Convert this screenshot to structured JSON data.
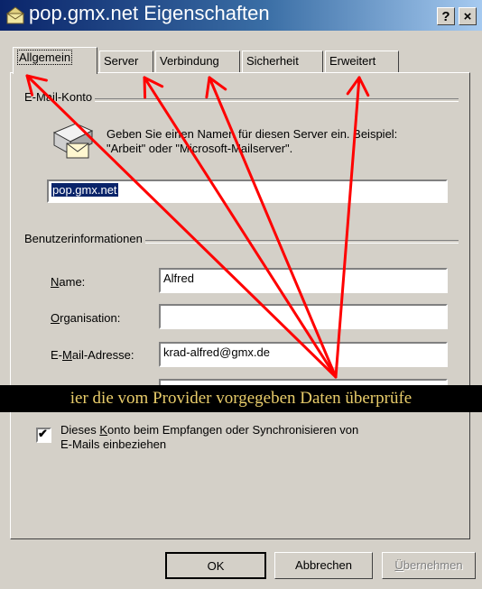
{
  "window": {
    "title": "pop.gmx.net Eigenschaften",
    "help_label": "?",
    "close_label": "×"
  },
  "tabs": [
    {
      "label": "Allgemein",
      "active": true
    },
    {
      "label": "Server"
    },
    {
      "label": "Verbindung"
    },
    {
      "label": "Sicherheit"
    },
    {
      "label": "Erweitert"
    }
  ],
  "account": {
    "group_label": "E-Mail-Konto",
    "description_line1": "Geben Sie einen Namen für diesen Server ein. Beispiel:",
    "description_line2": "\"Arbeit\" oder \"Microsoft-Mailserver\".",
    "name_value": "pop.gmx.net"
  },
  "user_info": {
    "group_label": "Benutzerinformationen",
    "name_label": "Name:",
    "name_value": "Alfred",
    "org_label": "Organisation:",
    "org_value": "",
    "email_label": "E-Mail-Adresse:",
    "email_value": "krad-alfred@gmx.de"
  },
  "annotation": {
    "banner_text": "ier die  vom Provider vorgegeben Daten überprüfe",
    "arrow_color": "#ff0000"
  },
  "options": {
    "include_label_line1": "Dieses Konto beim Empfangen oder Synchronisieren von",
    "include_label_line2": "E-Mails einbeziehen",
    "include_checked": true,
    "check_mark": "✔"
  },
  "buttons": {
    "ok": "OK",
    "cancel": "Abbrechen",
    "apply": "Übernehmen"
  }
}
